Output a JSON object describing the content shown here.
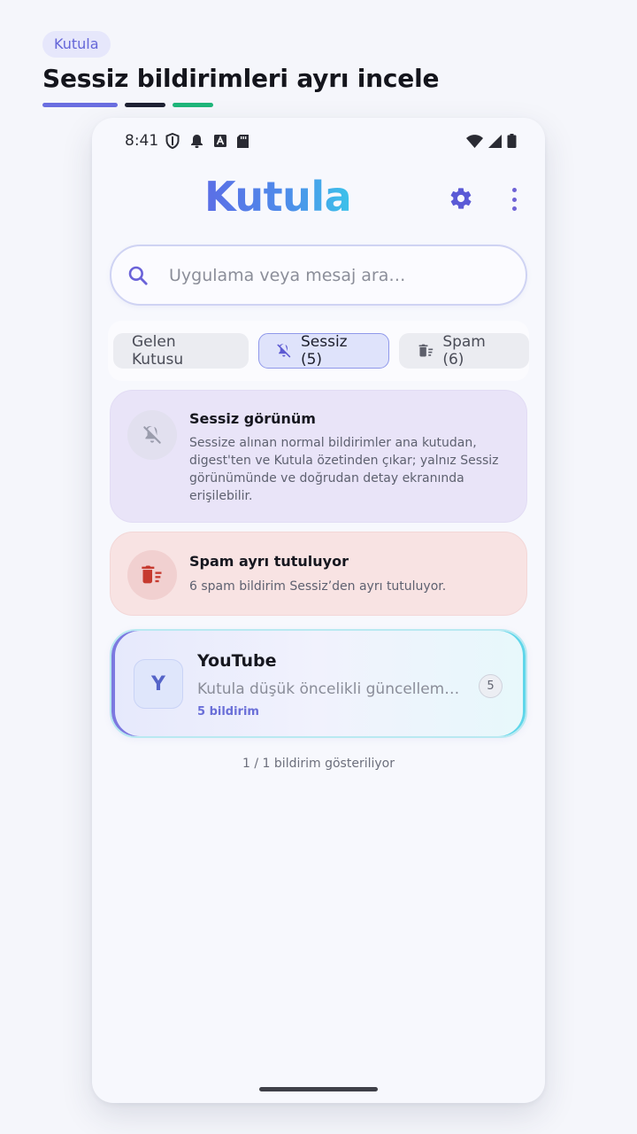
{
  "header": {
    "tag": "Kutula",
    "headline": "Sessiz bildirimleri ayrı incele"
  },
  "status_bar": {
    "time": "8:41",
    "left_icons": [
      "shield-icon",
      "notification-bell-icon",
      "app-a-icon",
      "sd-card-icon"
    ],
    "right_icons": [
      "wifi-icon",
      "cell-signal-icon",
      "battery-icon"
    ]
  },
  "app": {
    "logo": "Kutula",
    "settings_icon": "gear-icon",
    "menu_icon": "more-vert-icon"
  },
  "search": {
    "placeholder": "Uygulama veya mesaj ara…",
    "value": ""
  },
  "tabs": [
    {
      "label": "Gelen Kutusu",
      "icon": "",
      "active": false
    },
    {
      "label": "Sessiz (5)",
      "icon": "bell-off-icon",
      "active": true
    },
    {
      "label": "Spam (6)",
      "icon": "delete-sweep-icon",
      "active": false
    }
  ],
  "cards": {
    "silent": {
      "icon": "bell-off-icon",
      "title": "Sessiz görünüm",
      "description": "Sessize alınan normal bildirimler ana kutudan, digest'ten ve Kutula özetinden çıkar; yalnız Sessiz görünümünde ve doğrudan detay ekranında erişilebilir."
    },
    "spam": {
      "icon": "delete-sweep-icon",
      "title": "Spam ayrı tutuluyor",
      "description": "6 spam bildirim Sessiz’den ayrı tutuluyor."
    }
  },
  "notification_group": {
    "avatar_letter": "Y",
    "app_name": "YouTube",
    "preview": "Kutula düşük öncelikli güncellemeler",
    "count_label": "5 bildirim",
    "badge": "5"
  },
  "footer": {
    "count_text": "1 / 1 bildirim gösteriliyor"
  },
  "colors": {
    "accent": "#6a6ee0",
    "logo_gradient_start": "#5b6ee6",
    "logo_gradient_end": "#3cc3ea",
    "silent_card_bg": "#e9e4f8",
    "spam_card_bg": "#f8e3e3",
    "spam_icon": "#c63a2f"
  }
}
